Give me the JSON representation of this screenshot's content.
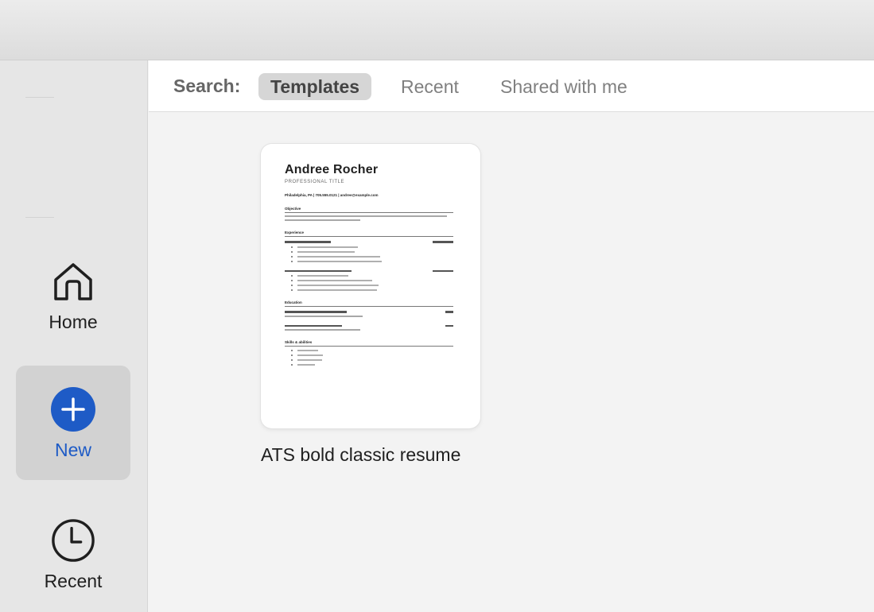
{
  "tabs_bar": {
    "search_label": "Search:",
    "tabs": [
      {
        "label": "Templates",
        "active": true
      },
      {
        "label": "Recent",
        "active": false
      },
      {
        "label": "Shared with me",
        "active": false
      }
    ]
  },
  "sidebar": {
    "items": [
      {
        "label": "Home",
        "icon": "home-icon"
      },
      {
        "label": "New",
        "icon": "plus-circle-icon",
        "active": true
      },
      {
        "label": "Recent",
        "icon": "clock-icon"
      }
    ],
    "accent": "#1e5bc6"
  },
  "template": {
    "caption": "ATS bold classic resume",
    "preview_name": "Andree Rocher",
    "preview_title": "PROFESSIONAL TITLE",
    "preview_contact": "Philadelphia, PA | 705.555.0121 | andree@example.com",
    "sections": [
      "Objective",
      "Experience",
      "Education",
      "Skills & abilities"
    ]
  }
}
